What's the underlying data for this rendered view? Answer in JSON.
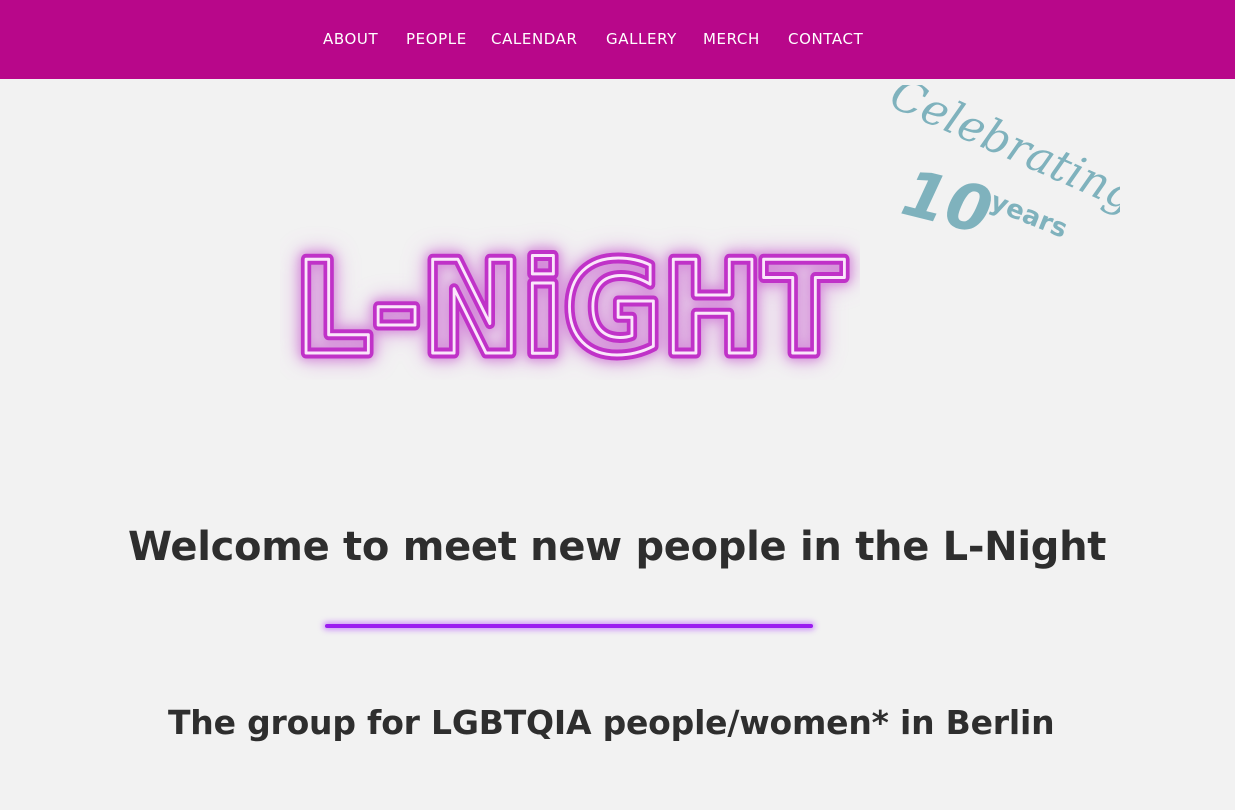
{
  "nav": {
    "items": [
      {
        "label": "ABOUT"
      },
      {
        "label": "PEOPLE"
      },
      {
        "label": "CALENDAR"
      },
      {
        "label": "GALLERY"
      },
      {
        "label": "MERCH"
      },
      {
        "label": "CONTACT"
      }
    ]
  },
  "hero": {
    "logo_text": "L-NiGHT",
    "badge": {
      "line1": "Celebrating",
      "number": "10",
      "line2": "years"
    }
  },
  "main": {
    "headline": "Welcome to meet new people in the L-Night",
    "subheadline": "The group for LGBTQIA people/women* in Berlin"
  },
  "colors": {
    "nav_background": "#b8078a",
    "page_background": "#f2f2f2",
    "text_dark": "#2e2e2e",
    "neon_purple": "#9b1cf0",
    "badge_teal": "#7fb2bd"
  }
}
